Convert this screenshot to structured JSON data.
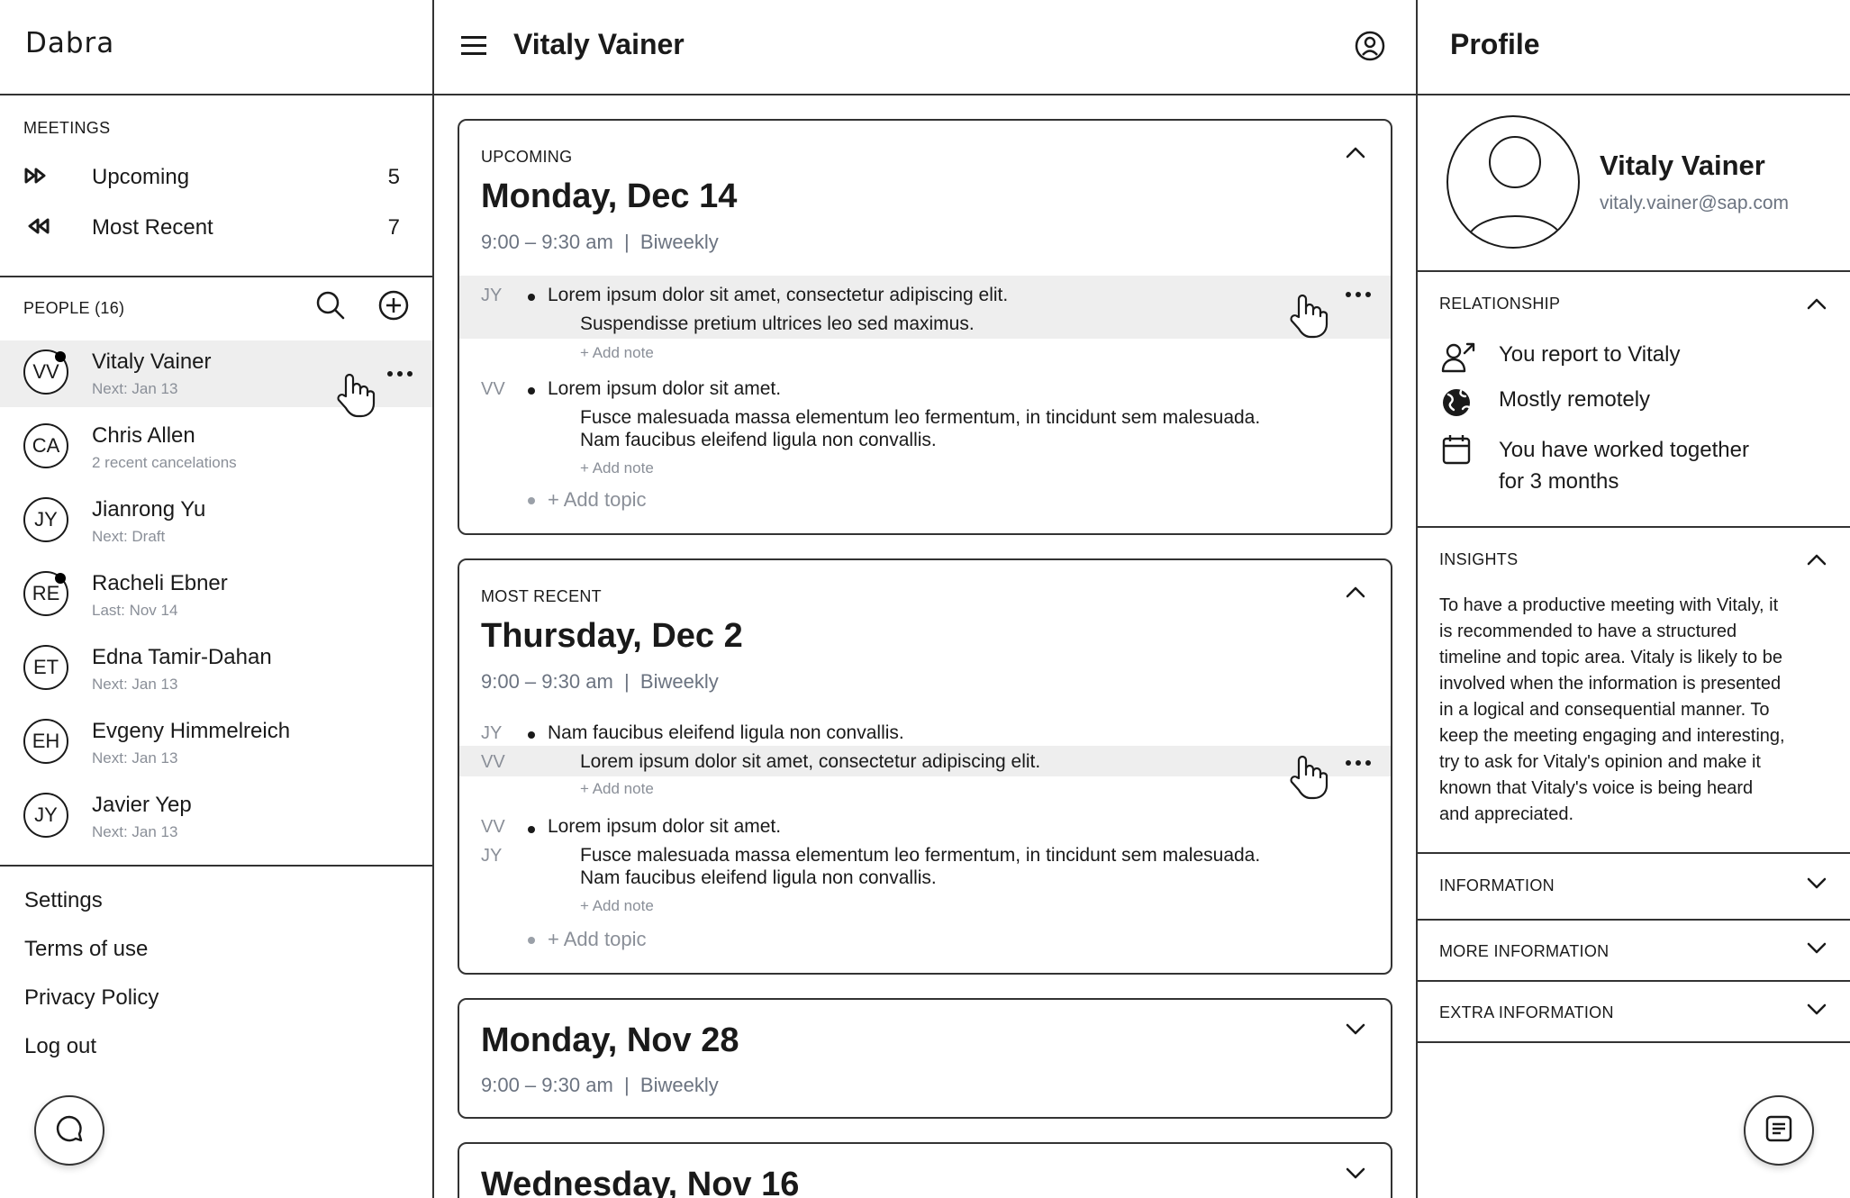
{
  "left": {
    "logo": "Dabra",
    "meetings": {
      "label": "MEETINGS",
      "items": [
        {
          "icon": "fast-forward-icon",
          "label": "Upcoming",
          "count": "5"
        },
        {
          "icon": "rewind-icon",
          "label": "Most Recent",
          "count": "7"
        }
      ]
    },
    "people": {
      "label": "PEOPLE (16)",
      "list": [
        {
          "initials": "VV",
          "name": "Vitaly Vainer",
          "sub": "Next: Jan 13",
          "dot": true
        },
        {
          "initials": "CA",
          "name": "Chris Allen",
          "sub": "2 recent cancelations",
          "dot": false
        },
        {
          "initials": "JY",
          "name": "Jianrong Yu",
          "sub": "Next: Draft",
          "dot": false
        },
        {
          "initials": "RE",
          "name": "Racheli Ebner",
          "sub": "Last: Nov 14",
          "dot": true
        },
        {
          "initials": "ET",
          "name": "Edna Tamir-Dahan",
          "sub": "Next: Jan 13",
          "dot": false
        },
        {
          "initials": "EH",
          "name": "Evgeny Himmelreich",
          "sub": "Next: Jan 13",
          "dot": false
        },
        {
          "initials": "JY",
          "name": "Javier Yep",
          "sub": "Next: Jan 13",
          "dot": false
        }
      ]
    },
    "footer": [
      "Settings",
      "Terms of use",
      "Privacy Policy",
      "Log out"
    ]
  },
  "mid": {
    "title": "Vitaly Vainer",
    "cards": [
      {
        "kicker": "UPCOMING",
        "date": "Monday, Dec 14",
        "time": "9:00 – 9:30 am  |  Biweekly",
        "topics": [
          {
            "initials": "JY",
            "text": "Lorem ipsum dolor sit amet, consectetur adipiscing elit.",
            "note": "Suspendisse pretium ultrices leo sed maximus.",
            "add_note": "+ Add note"
          },
          {
            "initials": "VV",
            "text": "Lorem ipsum dolor sit amet.",
            "note1": "Fusce malesuada massa elementum leo fermentum, in tincidunt sem malesuada.",
            "note2": "Nam faucibus eleifend ligula non convallis.",
            "add_note": "+ Add note"
          }
        ],
        "add_topic": "+ Add topic"
      },
      {
        "kicker": "MOST RECENT",
        "date": "Thursday, Dec 2",
        "time": "9:00 – 9:30 am  |  Biweekly",
        "topics": [
          {
            "initials": "JY",
            "initials2": "VV",
            "text": "Nam faucibus eleifend ligula non convallis.",
            "note": "Lorem ipsum dolor sit amet, consectetur adipiscing elit.",
            "add_note": "+ Add note"
          },
          {
            "initials": "VV",
            "initials2": "JY",
            "text": "Lorem ipsum dolor sit amet.",
            "note1": "Fusce malesuada massa elementum leo fermentum, in tincidunt sem malesuada.",
            "note2": "Nam faucibus eleifend ligula non convallis.",
            "add_note": "+ Add note"
          }
        ],
        "add_topic": "+ Add topic"
      },
      {
        "date": "Monday, Nov 28",
        "time": "9:00 – 9:30 am  |  Biweekly"
      },
      {
        "date": "Wednesday, Nov 16"
      }
    ]
  },
  "right": {
    "title": "Profile",
    "name": "Vitaly Vainer",
    "email": "vitaly.vainer@sap.com",
    "relationship": {
      "label": "RELATIONSHIP",
      "items": [
        {
          "icon": "person-report-icon",
          "line1": "You report to Vitaly"
        },
        {
          "icon": "globe-icon",
          "line1": "Mostly remotely"
        },
        {
          "icon": "calendar-icon",
          "line1": "You have worked together",
          "line2": "for 3 months"
        }
      ]
    },
    "insights": {
      "label": "INSIGHTS",
      "lines": [
        "To have a productive meeting with Vitaly, it",
        "is recommended to have a structured",
        "timeline and topic area. Vitaly is likely to be",
        "involved when the information is presented",
        "in a logical and consequential manner. To",
        "keep the meeting engaging and interesting,",
        "try to ask for Vitaly's opinion and make it",
        "known that Vitaly's voice is being heard",
        "and appreciated."
      ]
    },
    "accordions": [
      "INFORMATION",
      "MORE INFORMATION",
      "EXTRA INFORMATION"
    ]
  }
}
